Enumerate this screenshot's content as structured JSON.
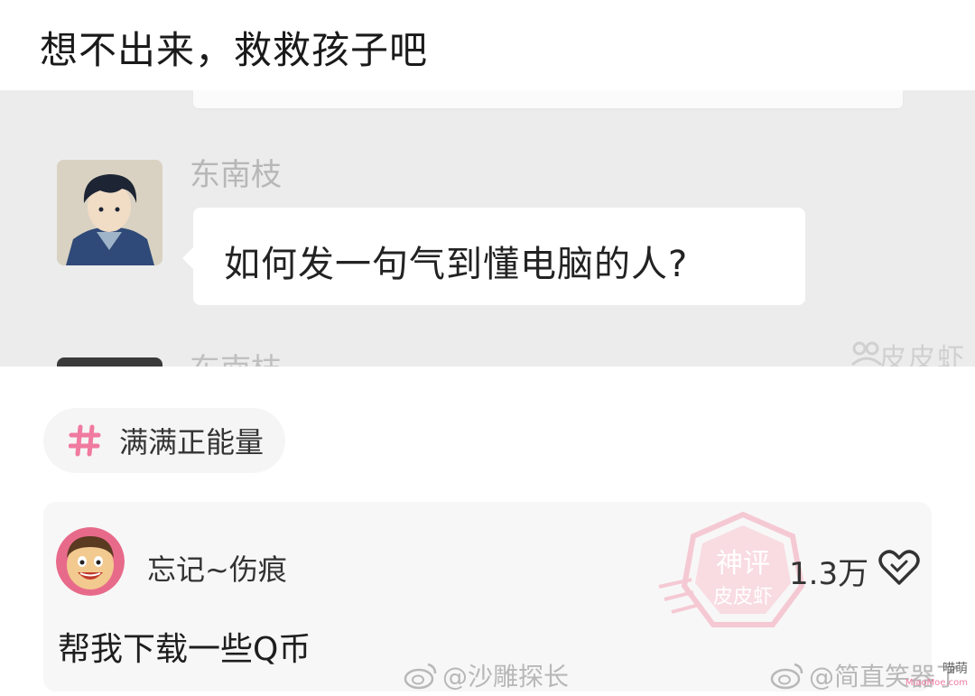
{
  "post": {
    "title": "想不出来，救救孩子吧"
  },
  "chat": {
    "sender_name": "东南枝",
    "message": "如何发一句气到懂电脑的人?",
    "next_sender_name": "东南枝",
    "watermark": "皮皮虾"
  },
  "topic": {
    "label": "满满正能量",
    "icon": "hash-icon"
  },
  "comment": {
    "username": "忘记~伤痕",
    "likes": "1.3万",
    "text": "帮我下载一些Q币",
    "stamp_line1": "神评",
    "stamp_line2": "皮皮虾"
  },
  "watermarks": {
    "left": "@沙雕探长",
    "right": "@简直笑器了",
    "corner_line1": "喵萌",
    "corner_line2": "MiaoMoe.com"
  },
  "colors": {
    "accent_pink": "#f07aa0",
    "stamp_pink": "#f4a4b6",
    "chat_bg": "#ececec"
  }
}
